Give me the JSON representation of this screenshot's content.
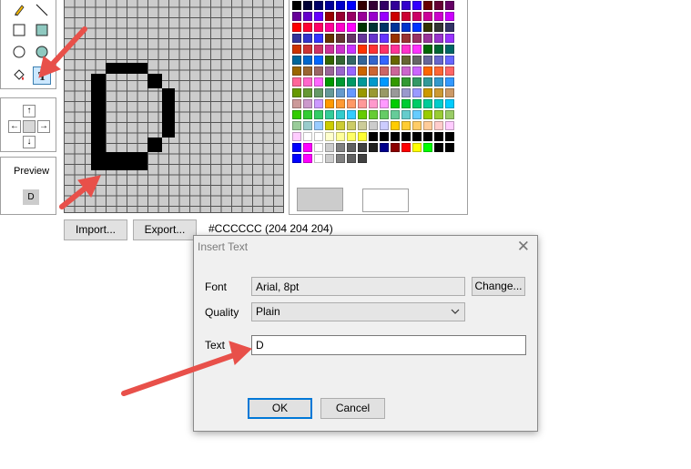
{
  "preview": {
    "label": "Preview",
    "char": "D"
  },
  "buttons": {
    "import": "Import...",
    "export": "Export..."
  },
  "color_info": "#CCCCCC (204 204 204)",
  "arrows": {
    "up": "↑",
    "left": "←",
    "right": "→",
    "down": "↓"
  },
  "dialog": {
    "title": "Insert Text",
    "close": "✕",
    "font_label": "Font",
    "font_value": "Arial, 8pt",
    "change_label": "Change...",
    "quality_label": "Quality",
    "quality_value": "Plain",
    "text_label": "Text",
    "text_value": "D",
    "ok_label": "OK",
    "cancel_label": "Cancel"
  },
  "colors": {
    "primary": "#cccccc",
    "secondary": "#ffffff",
    "annotation": "#e8504a"
  },
  "tools": [
    "pencil-icon",
    "line-icon",
    "rectangle-icon",
    "filled-rectangle-icon",
    "ellipse-icon",
    "filled-ellipse-icon",
    "fill-bucket-icon",
    "text-tool-icon"
  ],
  "palette_rows": [
    [
      "#000000",
      "#000033",
      "#000066",
      "#000099",
      "#0000cc",
      "#0000ff",
      "#330000",
      "#330033",
      "#330066",
      "#330099",
      "#3300cc",
      "#3300ff",
      "#660000",
      "#660033",
      "#660066"
    ],
    [
      "#660099",
      "#6600cc",
      "#6600ff",
      "#990000",
      "#990033",
      "#990066",
      "#990099",
      "#9900cc",
      "#9900ff",
      "#cc0000",
      "#cc0033",
      "#cc0066",
      "#cc0099",
      "#cc00cc",
      "#cc00ff"
    ],
    [
      "#ff0000",
      "#ff0033",
      "#ff0066",
      "#ff0099",
      "#ff00cc",
      "#ff00ff",
      "#003300",
      "#003333",
      "#003366",
      "#003399",
      "#0033cc",
      "#0033ff",
      "#333300",
      "#333333",
      "#333366"
    ],
    [
      "#333399",
      "#3333cc",
      "#3333ff",
      "#663300",
      "#663333",
      "#663366",
      "#663399",
      "#6633cc",
      "#6633ff",
      "#993300",
      "#993333",
      "#993366",
      "#993399",
      "#9933cc",
      "#9933ff"
    ],
    [
      "#cc3300",
      "#cc3333",
      "#cc3366",
      "#cc3399",
      "#cc33cc",
      "#cc33ff",
      "#ff3300",
      "#ff3333",
      "#ff3366",
      "#ff3399",
      "#ff33cc",
      "#ff33ff",
      "#006600",
      "#006633",
      "#006666"
    ],
    [
      "#006699",
      "#0066cc",
      "#0066ff",
      "#336600",
      "#336633",
      "#336666",
      "#336699",
      "#3366cc",
      "#3366ff",
      "#666600",
      "#666633",
      "#666666",
      "#666699",
      "#6666cc",
      "#6666ff"
    ],
    [
      "#996600",
      "#996633",
      "#996666",
      "#996699",
      "#9966cc",
      "#9966ff",
      "#cc6600",
      "#cc6633",
      "#cc6666",
      "#cc6699",
      "#cc66cc",
      "#cc66ff",
      "#ff6600",
      "#ff6633",
      "#ff6666"
    ],
    [
      "#ff6699",
      "#ff66cc",
      "#ff66ff",
      "#009900",
      "#009933",
      "#009966",
      "#009999",
      "#0099cc",
      "#0099ff",
      "#339900",
      "#339933",
      "#339966",
      "#339999",
      "#3399cc",
      "#3399ff"
    ],
    [
      "#669900",
      "#669933",
      "#669966",
      "#669999",
      "#6699cc",
      "#6699ff",
      "#999900",
      "#999933",
      "#999966",
      "#999999",
      "#9999cc",
      "#9999ff",
      "#cc9900",
      "#cc9933",
      "#cc9966"
    ],
    [
      "#cc9999",
      "#cc99cc",
      "#cc99ff",
      "#ff9900",
      "#ff9933",
      "#ff9966",
      "#ff9999",
      "#ff99cc",
      "#ff99ff",
      "#00cc00",
      "#00cc33",
      "#00cc66",
      "#00cc99",
      "#00cccc",
      "#00ccff"
    ],
    [
      "#33cc00",
      "#33cc33",
      "#33cc66",
      "#33cc99",
      "#33cccc",
      "#33ccff",
      "#66cc00",
      "#66cc33",
      "#66cc66",
      "#66cc99",
      "#66cccc",
      "#66ccff",
      "#99cc00",
      "#99cc33",
      "#99cc66"
    ],
    [
      "#99cc99",
      "#99cccc",
      "#99ccff",
      "#cccc00",
      "#cccc33",
      "#cccc66",
      "#cccc99",
      "#cccccc",
      "#ccccff",
      "#ffcc00",
      "#ffcc33",
      "#ffcc66",
      "#ffcc99",
      "#ffcccc",
      "#ffccff"
    ],
    [
      "#ffccff",
      "#ffffff",
      "#ffffff",
      "#ffffcc",
      "#ffff99",
      "#ffff66",
      "#ffff33",
      "#000000",
      "#000000",
      "#000000",
      "#000000",
      "#000000",
      "#000000",
      "#000000",
      "#000000"
    ],
    [
      "#0000ff",
      "#ff00ff",
      "#ffffff",
      "#cccccc",
      "#808080",
      "#606060",
      "#404040",
      "#202020",
      "#00008b",
      "#8b0000",
      "#ff0000",
      "#ffff00",
      "#00ff00",
      "#000000",
      "#000000"
    ],
    [
      "#0000ff",
      "#ff00ff",
      "#ffffff",
      "#cccccc",
      "#808080",
      "#606060",
      "#404040"
    ]
  ]
}
